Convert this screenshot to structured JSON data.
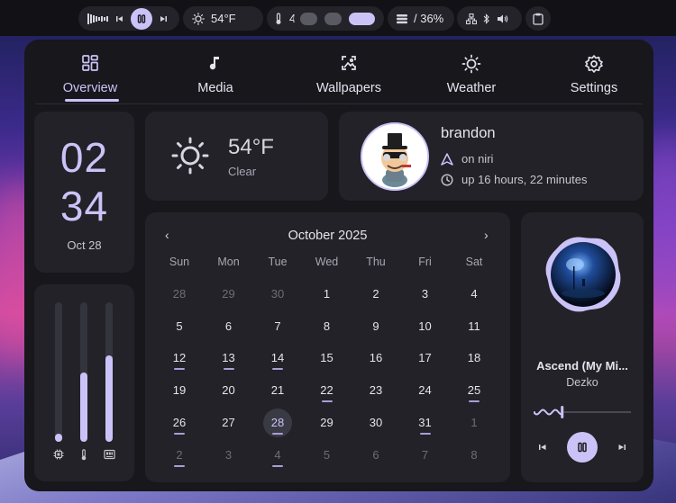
{
  "topbar": {
    "temperature": "54°F",
    "cpu_temp": "49°",
    "memory": "/ 36%"
  },
  "tabs": [
    {
      "label": "Overview",
      "icon": "grid-icon"
    },
    {
      "label": "Media",
      "icon": "music-note-icon"
    },
    {
      "label": "Wallpapers",
      "icon": "image-icon"
    },
    {
      "label": "Weather",
      "icon": "sun-icon"
    },
    {
      "label": "Settings",
      "icon": "gear-icon"
    }
  ],
  "clock": {
    "hours": "02",
    "minutes": "34",
    "date": "Oct 28"
  },
  "weather": {
    "temp": "54°F",
    "condition": "Clear"
  },
  "profile": {
    "username": "brandon",
    "wm": "on niri",
    "uptime": "up 16 hours, 22 minutes"
  },
  "sliders": {
    "cpu_level": 0.06,
    "temp_level": 0.5,
    "memory_level": 0.62
  },
  "calendar": {
    "month": "October 2025",
    "weekdays": [
      "Sun",
      "Mon",
      "Tue",
      "Wed",
      "Thu",
      "Fri",
      "Sat"
    ],
    "weeks": [
      [
        "28",
        "29",
        "30",
        "1",
        "2",
        "3",
        "4"
      ],
      [
        "5",
        "6",
        "7",
        "8",
        "9",
        "10",
        "11"
      ],
      [
        "12",
        "13",
        "14",
        "15",
        "16",
        "17",
        "18"
      ],
      [
        "19",
        "20",
        "21",
        "22",
        "23",
        "24",
        "25"
      ],
      [
        "26",
        "27",
        "28",
        "29",
        "30",
        "31",
        "1"
      ],
      [
        "2",
        "3",
        "4",
        "5",
        "6",
        "7",
        "8"
      ]
    ]
  },
  "media": {
    "title": "Ascend (My Mi...",
    "artist": "Dezko",
    "progress": 0.28
  },
  "colors": {
    "accent": "#cbc3f7",
    "panel": "#17171c",
    "card": "#222228"
  }
}
